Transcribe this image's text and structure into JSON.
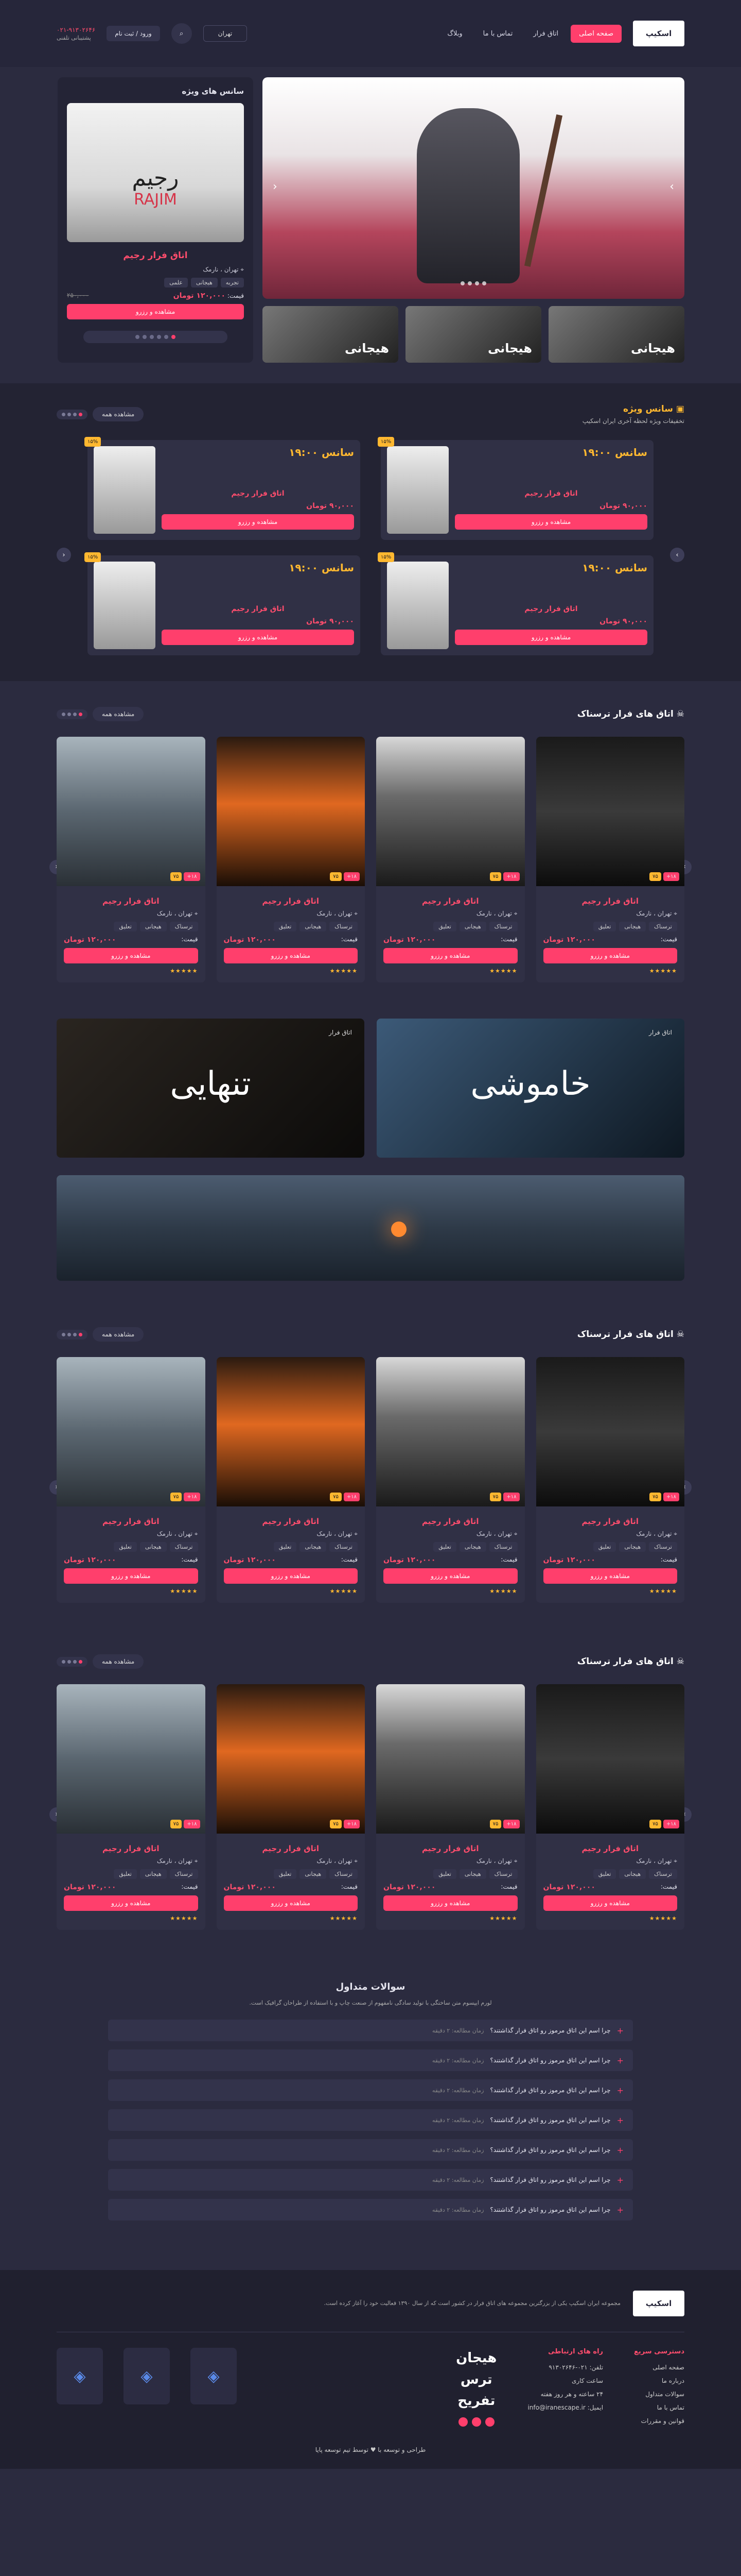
{
  "header": {
    "logo": "اسکیپ",
    "nav": [
      "صفحه اصلی",
      "اتاق فرار",
      "تماس با ما",
      "وبلاگ"
    ],
    "city": "تهران",
    "login": "ورود / ثبت نام",
    "phone": "۰۲۱-۹۱۳۰۲۶۴۶",
    "phone_sub": "پشتیبانی تلفنی"
  },
  "hero": {
    "thumbs": [
      "هیجانی",
      "هیجانی",
      "هیجانی"
    ],
    "special": {
      "title": "سانس های ویژه",
      "poster_title": "رجیم",
      "poster_red": "RAJIM",
      "card_title": "اتاق فرار رجیم",
      "meta": "تهران ، نارمک",
      "tags": [
        "تجربه",
        "هیجانی",
        "علمی"
      ],
      "price_label": "قیمت:",
      "price": "۱۲۰,۰۰۰ تومان",
      "old_price": "۲۵۰,۰۰۰",
      "button": "مشاهده و رزرو"
    }
  },
  "sessions": {
    "title": "سانس ویژه",
    "subtitle": "تخفیفات ویژه لحظه آخری ایران اسکیپ",
    "more": "مشاهده همه",
    "cards": [
      {
        "time": "سانس ۱۹:۰۰",
        "title": "اتاق فرار رجیم",
        "meta": "تهران ، نارمک",
        "price": "۹۰,۰۰۰ تومان",
        "badge": "۱۵%",
        "button": "مشاهده و رزرو"
      },
      {
        "time": "سانس ۱۹:۰۰",
        "title": "اتاق فرار رجیم",
        "meta": "تهران ، نارمک",
        "price": "۹۰,۰۰۰ تومان",
        "badge": "۱۵%",
        "button": "مشاهده و رزرو"
      },
      {
        "time": "سانس ۱۹:۰۰",
        "title": "اتاق فرار رجیم",
        "meta": "تهران ، نارمک",
        "price": "۹۰,۰۰۰ تومان",
        "badge": "۱۵%",
        "button": "مشاهده و رزرو"
      },
      {
        "time": "سانس ۱۹:۰۰",
        "title": "اتاق فرار رجیم",
        "meta": "تهران ، نارمک",
        "price": "۹۰,۰۰۰ تومان",
        "badge": "۱۵%",
        "button": "مشاهده و رزرو"
      }
    ]
  },
  "rooms_title": "اتاق های فرار ترسناک",
  "room": {
    "title": "اتاق فرار رجیم",
    "meta": "تهران ، نارمک",
    "tags": [
      "ترسناک",
      "هیجانی",
      "تعلیق"
    ],
    "price_label": "قیمت:",
    "price": "۱۲۰,۰۰۰ تومان",
    "button": "مشاهده و رزرو",
    "badge1": "۱۸+",
    "badge2": "۷۵"
  },
  "banners": {
    "left_small": "اتاق فرار",
    "left_big": "تنهایی",
    "right_small": "اتاق فرار",
    "right_big": "خاموشی"
  },
  "faq": {
    "title": "سوالات متداول",
    "intro": "لورم ایپسوم متن ساختگی با تولید سادگی نامفهوم از صنعت چاپ و با استفاده از طراحان گرافیک است.",
    "question": "چرا اسم این اتاق مرموز رو اتاق فرار گذاشتند؟",
    "sub": "زمان مطالعه: ۲ دقیقه"
  },
  "footer": {
    "about": "مجموعه ایران اسکیپ یکی از بزرگترین مجموعه های اتاق فرار در کشور است که از سال ۱۳۹۰ فعالیت خود را آغاز کرده است.",
    "col1_title": "دسترسی سریع",
    "col1": [
      "صفحه اصلی",
      "درباره ما",
      "سوالات متداول",
      "تماس با ما",
      "قوانین و مقررات"
    ],
    "col2_title": "راه های ارتباطی",
    "col2": [
      "تلفن: ۰۲۱-۹۱۳۰۲۶۴۶",
      "ساعت کاری",
      "۲۴ ساعته و هر روز هفته",
      "ایمیل: info@iranescape.ir"
    ],
    "slogan": [
      "هیجان",
      "ترس",
      "تفریح"
    ],
    "copyright": "طراحی و توسعه با ♥ توسط تیم توسعه پایا"
  },
  "colors": {
    "accent": "#ff3f6c",
    "gold": "#ffb830",
    "bg": "#2b2b3f"
  }
}
